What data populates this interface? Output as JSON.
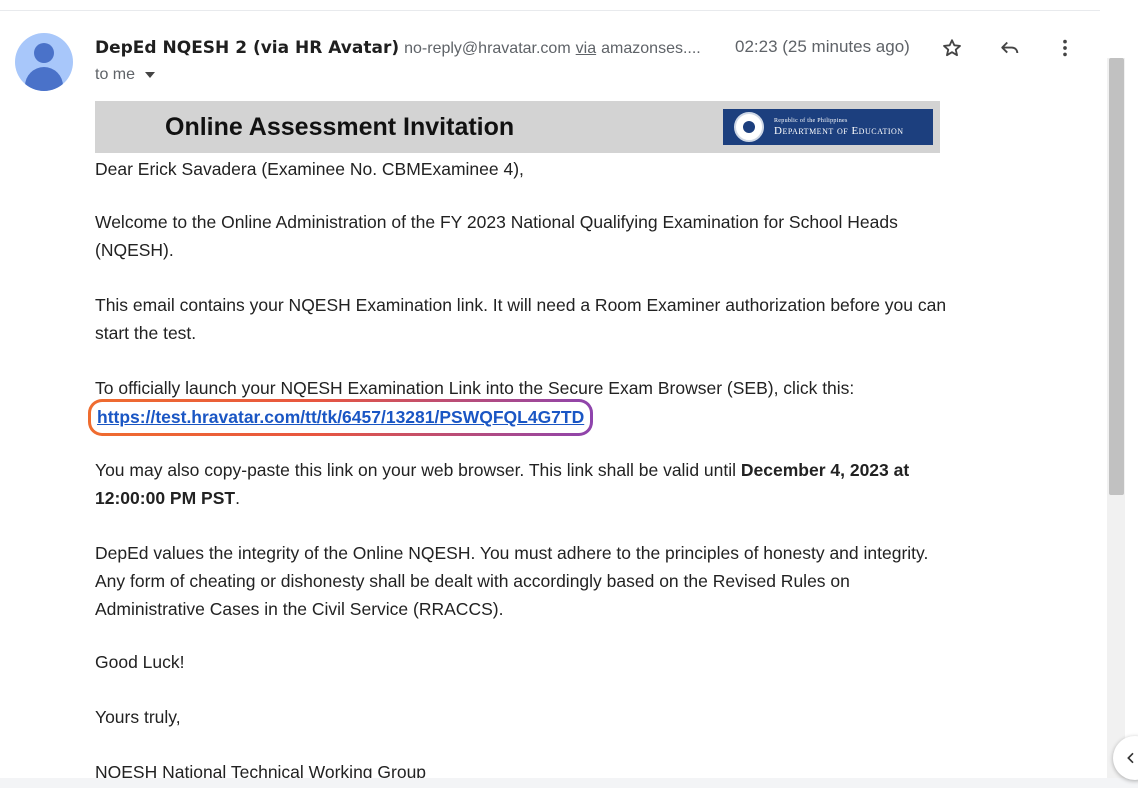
{
  "email": {
    "sender_name": "DepEd NQESH 2 (via HR Avatar)",
    "sender_email": "no-reply@hravatar.com",
    "via_word": "via",
    "via_domain": "amazonses....",
    "timestamp": "02:23 (25 minutes ago)",
    "to_line": "to me"
  },
  "icons": {
    "star": "star-icon",
    "reply": "reply-icon",
    "more": "more-vert-icon",
    "collapse": "chevron-left-icon"
  },
  "banner": {
    "title": "Online Assessment Invitation",
    "logo_top": "Republic of the Philippines",
    "logo_main": "Department of Education",
    "background": "#d3d3d3",
    "logo_color": "#1c3f7e"
  },
  "body": {
    "greeting": "Dear Erick Savadera (Examinee No. CBMExaminee 4),",
    "welcome": "Welcome to the Online Administration of the FY 2023 National Qualifying Examination for School Heads (NQESH).",
    "contains": "This email contains your NQESH Examination link. It will need a Room Examiner authorization before you can start the test.",
    "launch": "To officially launch your NQESH Examination Link into the Secure Exam Browser (SEB), click this:",
    "link": "https://test.hravatar.com/tt/tk/6457/13281/PSWQFQL4G7TD",
    "copy_paste": "You may also copy-paste this link on your web browser. This link shall be valid until ",
    "valid_until": "December 4, 2023 at 12:00:00 PM PST",
    "period": ".",
    "integrity": "DepEd values the integrity of the Online NQESH. You must adhere to the principles of honesty and integrity. Any form of cheating or dishonesty shall be dealt with accordingly based on the Revised Rules on Administrative Cases in the Civil Service (RRACCS).",
    "good_luck": "Good Luck!",
    "yours_truly": "Yours truly,",
    "signature": "NQESH National Technical Working Group"
  },
  "colors": {
    "link": "#1a56c4",
    "highlight_border": "#ef6c2f",
    "avatar": "#a8c7fa"
  }
}
